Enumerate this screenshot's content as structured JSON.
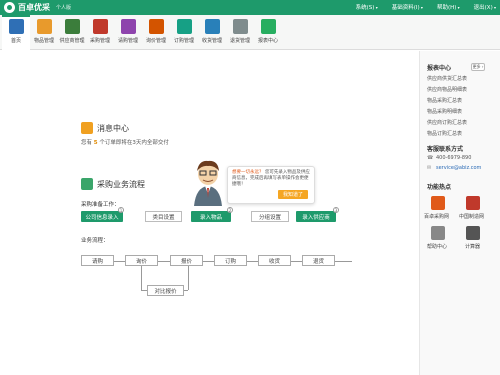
{
  "app": {
    "name": "百卓优采",
    "edition": "个人版"
  },
  "menu": [
    "系统(S)",
    "基础资料(I)",
    "帮助(H)",
    "退出(X)"
  ],
  "toolbar": [
    {
      "label": "首页",
      "color": "#2f6fb5",
      "active": true
    },
    {
      "label": "物品管理",
      "color": "#e89a2c"
    },
    {
      "label": "供应商管理",
      "color": "#3b7d3b"
    },
    {
      "label": "采购管理",
      "color": "#c0392b"
    },
    {
      "label": "请购管理",
      "color": "#8e44ad"
    },
    {
      "label": "询价管理",
      "color": "#d35400"
    },
    {
      "label": "订购管理",
      "color": "#16a085"
    },
    {
      "label": "收货管理",
      "color": "#2980b9"
    },
    {
      "label": "退货管理",
      "color": "#7f8c8d"
    },
    {
      "label": "报表中心",
      "color": "#27ae60"
    }
  ],
  "message": {
    "title": "消息中心",
    "text_pre": "您有",
    "count": "5",
    "text_post": "个订单即将在3天内全部交付"
  },
  "flow": {
    "title": "采购业务流程",
    "prep_label": "采购准备工作：",
    "prep_buttons": [
      "公司信息录入",
      "类目设置",
      "录入物品",
      "分组设置",
      "录入供应商"
    ],
    "business_label": "业务流程：",
    "steps": [
      "请购",
      "询价",
      "报价",
      "订购",
      "收货",
      "退货"
    ],
    "compare": "对比报价"
  },
  "bubble": {
    "highlight": "想要一切永远？",
    "text": "您可先录入物品及供应商信息，完成后再填写表单操作会更便捷哦！",
    "button": "我知道了"
  },
  "right": {
    "reports_title": "报表中心",
    "more": "更多 ›",
    "reports": [
      "供应商供货汇总表",
      "供应商物品明细表",
      "物品采购汇总表",
      "物品采购明细表",
      "供应商订购汇总表",
      "物品订购汇总表"
    ],
    "contact_title": "客服联系方式",
    "phone": "400-6979-890",
    "email": "service@abiz.com",
    "hot_title": "功能热点",
    "hot": [
      {
        "label": "百卓采购网",
        "color": "#e05a1a"
      },
      {
        "label": "中国制造网",
        "color": "#c0392b"
      },
      {
        "label": "帮助中心",
        "color": "#777"
      },
      {
        "label": "计算器",
        "color": "#555"
      }
    ]
  }
}
